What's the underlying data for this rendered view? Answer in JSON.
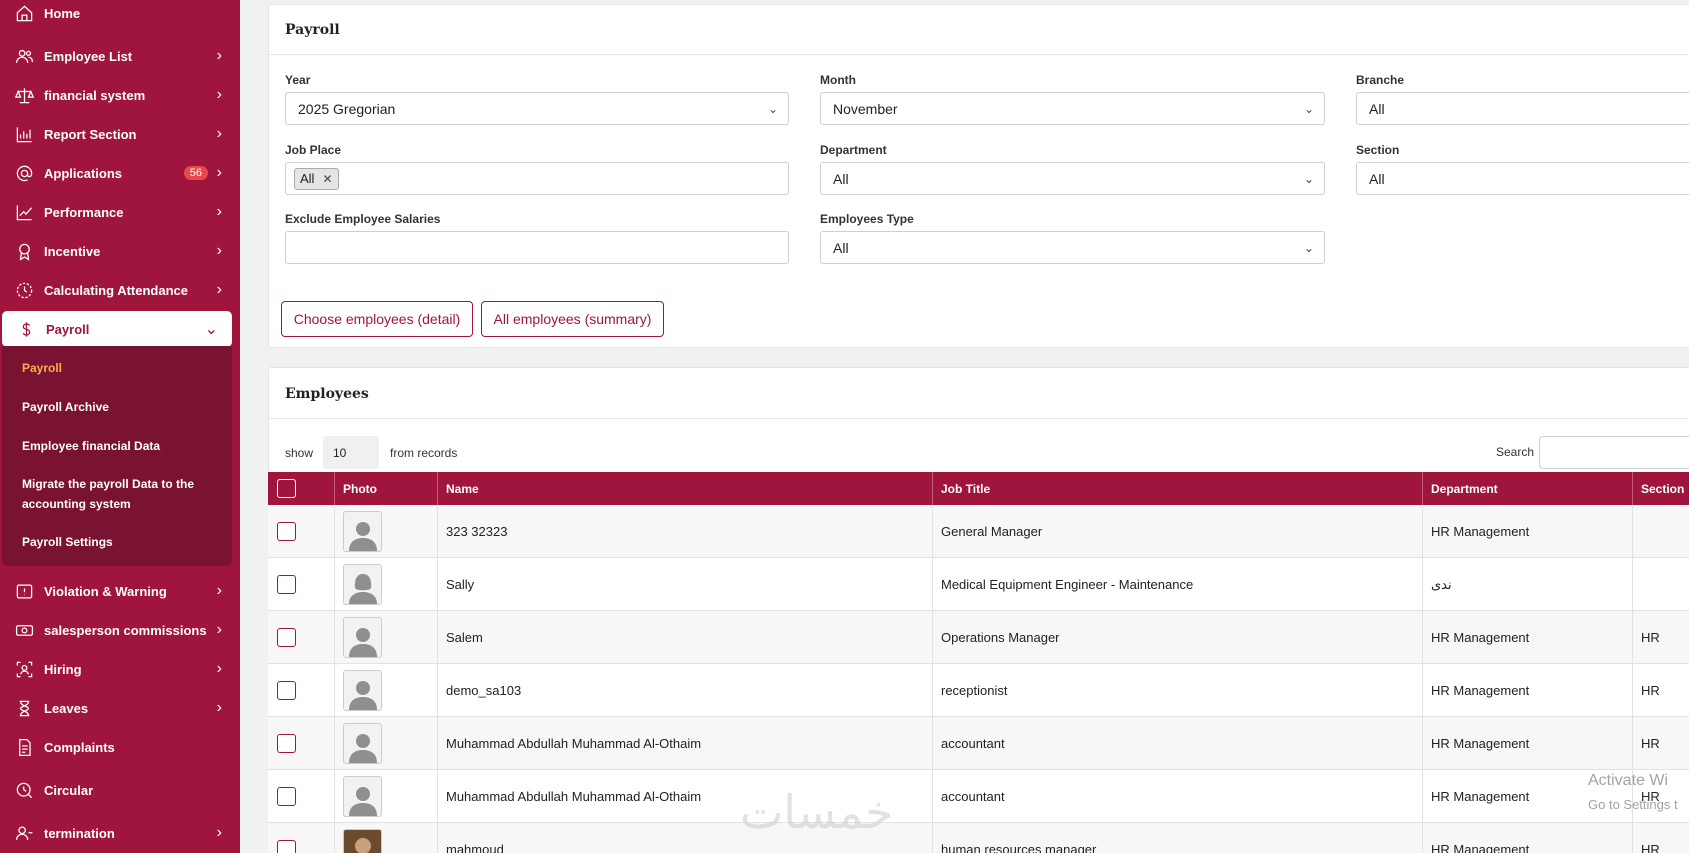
{
  "sidebar": {
    "items": [
      {
        "label": "Home",
        "icon": "home-icon"
      },
      {
        "label": "Employee List",
        "icon": "users-icon"
      },
      {
        "label": "financial system",
        "icon": "scales-icon"
      },
      {
        "label": "Report Section",
        "icon": "chart-icon"
      },
      {
        "label": "Applications",
        "icon": "at-icon",
        "badge": "56"
      },
      {
        "label": "Performance",
        "icon": "trend-icon"
      },
      {
        "label": "Incentive",
        "icon": "award-icon"
      },
      {
        "label": "Calculating Attendance",
        "icon": "clock-icon"
      },
      {
        "label": "Payroll",
        "icon": "dollar-icon"
      },
      {
        "label": "Violation & Warning",
        "icon": "warning-icon"
      },
      {
        "label": "salesperson commissions",
        "icon": "cash-icon"
      },
      {
        "label": "Hiring",
        "icon": "user-scan-icon"
      },
      {
        "label": "Leaves",
        "icon": "hourglass-icon"
      },
      {
        "label": "Complaints",
        "icon": "document-icon"
      },
      {
        "label": "Circular",
        "icon": "clock-search-icon"
      },
      {
        "label": "termination",
        "icon": "user-remove-icon"
      }
    ],
    "submenu": [
      "Payroll",
      "Payroll Archive",
      "Employee financial Data",
      "Migrate the payroll Data to the accounting system",
      "Payroll Settings"
    ]
  },
  "filters": {
    "title": "Payroll",
    "year_label": "Year",
    "year_value": "2025 Gregorian",
    "month_label": "Month",
    "month_value": "November",
    "branche_label": "Branche",
    "branche_value": "All",
    "job_place_label": "Job Place",
    "job_place_tag": "All",
    "department_label": "Department",
    "department_value": "All",
    "section_label": "Section",
    "section_value": "All",
    "exclude_label": "Exclude Employee Salaries",
    "employees_type_label": "Employees Type",
    "employees_type_value": "All",
    "btn_detail": "Choose employees (detail)",
    "btn_summary": "All employees (summary)"
  },
  "employees": {
    "title": "Employees",
    "show_label": "show",
    "show_value": "10",
    "records_label": "from records",
    "search_label": "Search",
    "columns": [
      "Photo",
      "Name",
      "Job Title",
      "Department",
      "Section"
    ],
    "rows": [
      {
        "name": "323 32323",
        "job": "General Manager",
        "dept": "HR Management",
        "section": "",
        "avatar": "male"
      },
      {
        "name": "Sally",
        "job": "Medical Equipment Engineer - Maintenance",
        "dept": "ندى",
        "section": "",
        "avatar": "female"
      },
      {
        "name": "Salem",
        "job": "Operations Manager",
        "dept": "HR Management",
        "section": "HR",
        "avatar": "male"
      },
      {
        "name": "demo_sa103",
        "job": "receptionist",
        "dept": "HR Management",
        "section": "HR",
        "avatar": "male"
      },
      {
        "name": "Muhammad Abdullah Muhammad Al-Othaim",
        "job": "accountant",
        "dept": "HR Management",
        "section": "HR",
        "avatar": "male"
      },
      {
        "name": "Muhammad Abdullah Muhammad Al-Othaim",
        "job": "accountant",
        "dept": "HR Management",
        "section": "HR",
        "avatar": "male"
      },
      {
        "name": "mahmoud",
        "job": "human resources manager",
        "dept": "HR Management",
        "section": "HR",
        "avatar": "photo"
      }
    ]
  },
  "overlay": {
    "activate_line1": "Activate Wi",
    "activate_line2": "Go to Settings t",
    "logo_text": "خمسات"
  },
  "colors": {
    "brand": "#a0153e",
    "submenu_bg": "#7a1232",
    "active_sub": "#f4b24a",
    "badge": "#e84a4a"
  }
}
